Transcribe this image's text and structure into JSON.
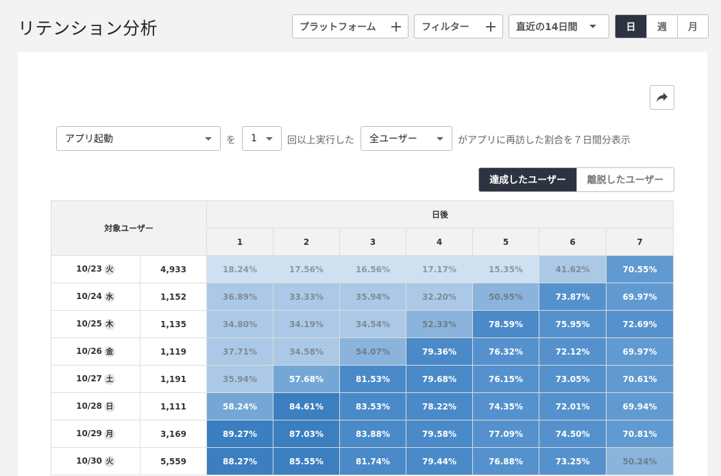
{
  "page": {
    "title": "リテンション分析"
  },
  "toolbar": {
    "platform_label": "プラットフォーム",
    "filter_label": "フィルター",
    "period_label": "直近の14日間",
    "granularity": [
      "日",
      "週",
      "月"
    ],
    "granularity_selected": "日"
  },
  "condition": {
    "event_value": "アプリ起動",
    "connector_wo": "を",
    "count_value": "1",
    "text_times": "回以上実行した",
    "segment_value": "全ユーザー",
    "text_suffix": "がアプリに再訪した割合を７日間分表示"
  },
  "view_toggle": {
    "achieved": "達成したユーザー",
    "churned": "離脱したユーザー",
    "selected": "achieved"
  },
  "table": {
    "header_target": "対象ユーザー",
    "header_days_after": "日後",
    "day_columns": [
      "1",
      "2",
      "3",
      "4",
      "5",
      "6",
      "7"
    ],
    "rows": [
      {
        "date": "10/23",
        "dow": "火",
        "users": "4,933",
        "values": [
          "18.24%",
          "17.56%",
          "16.56%",
          "17.17%",
          "15.35%",
          "41.62%",
          "70.55%"
        ]
      },
      {
        "date": "10/24",
        "dow": "水",
        "users": "1,152",
        "values": [
          "36.89%",
          "33.33%",
          "35.94%",
          "32.20%",
          "50.95%",
          "73.87%",
          "69.97%"
        ]
      },
      {
        "date": "10/25",
        "dow": "木",
        "users": "1,135",
        "values": [
          "34.80%",
          "34.19%",
          "34.54%",
          "52.33%",
          "78.59%",
          "75.95%",
          "72.69%"
        ]
      },
      {
        "date": "10/26",
        "dow": "金",
        "users": "1,119",
        "values": [
          "37.71%",
          "34.58%",
          "54.07%",
          "79.36%",
          "76.32%",
          "72.12%",
          "69.97%"
        ]
      },
      {
        "date": "10/27",
        "dow": "土",
        "users": "1,191",
        "values": [
          "35.94%",
          "57.68%",
          "81.53%",
          "79.68%",
          "76.15%",
          "73.05%",
          "70.61%"
        ]
      },
      {
        "date": "10/28",
        "dow": "日",
        "users": "1,111",
        "values": [
          "58.24%",
          "84.61%",
          "83.53%",
          "78.22%",
          "74.35%",
          "72.01%",
          "69.94%"
        ]
      },
      {
        "date": "10/29",
        "dow": "月",
        "users": "3,169",
        "values": [
          "89.27%",
          "87.03%",
          "83.88%",
          "79.58%",
          "77.09%",
          "74.50%",
          "70.81%"
        ]
      },
      {
        "date": "10/30",
        "dow": "火",
        "users": "5,559",
        "values": [
          "88.27%",
          "85.55%",
          "81.74%",
          "79.44%",
          "76.88%",
          "73.25%",
          "50.24%"
        ]
      }
    ]
  }
}
